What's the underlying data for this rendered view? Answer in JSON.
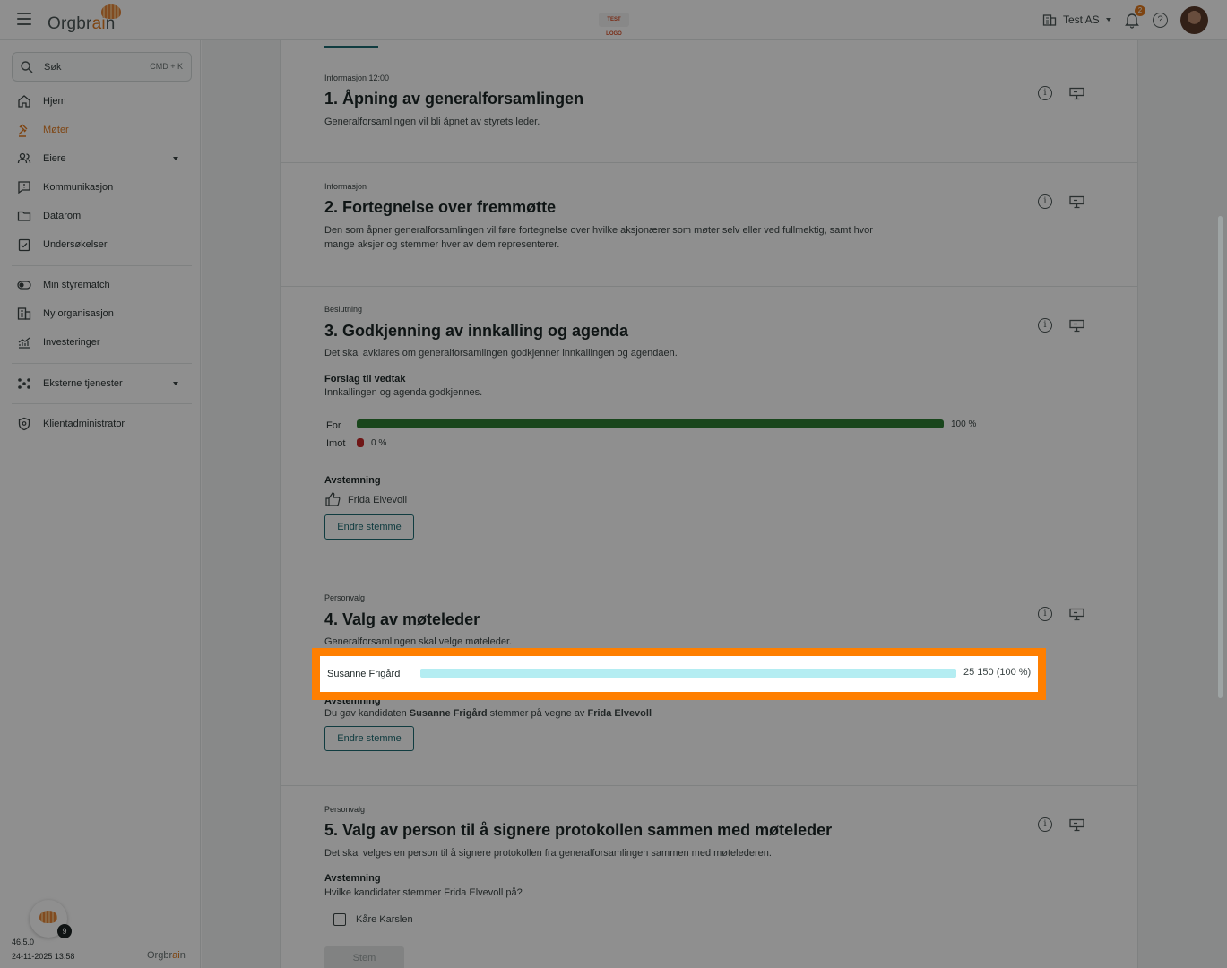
{
  "header": {
    "brand_pre": "Orgbr",
    "brand_ai": "ai",
    "brand_post": "n",
    "test_logo": "TEST LOGO",
    "org_name": "Test AS",
    "notification_count": "2",
    "help_glyph": "?"
  },
  "sidebar": {
    "search_placeholder": "Søk",
    "search_shortcut": "CMD + K",
    "items": [
      {
        "label": "Hjem",
        "icon": "home-icon"
      },
      {
        "label": "Møter",
        "icon": "gavel-icon",
        "active": true
      },
      {
        "label": "Eiere",
        "icon": "people-icon",
        "expandable": true
      },
      {
        "label": "Kommunikasjon",
        "icon": "message-icon"
      },
      {
        "label": "Datarom",
        "icon": "folder-icon"
      },
      {
        "label": "Undersøkelser",
        "icon": "clipboard-icon"
      },
      {
        "label": "Min styrematch",
        "icon": "toggle-icon"
      },
      {
        "label": "Ny organisasjon",
        "icon": "building-icon"
      },
      {
        "label": "Investeringer",
        "icon": "chart-icon"
      },
      {
        "label": "Eksterne tjenester",
        "icon": "network-icon",
        "expandable": true
      },
      {
        "label": "Klientadministrator",
        "icon": "shield-icon"
      }
    ],
    "assistant_badge_count": "9",
    "version": "46.5.0",
    "timestamp": "24-11-2025 13:58",
    "footer_brand_pre": "Orgbr",
    "footer_brand_ai": "ai",
    "footer_brand_post": "n"
  },
  "agenda": [
    {
      "kicker": "Informasjon 12:00",
      "title": "1. Åpning av generalforsamlingen",
      "description": "Generalforsamlingen vil bli åpnet av styrets leder."
    },
    {
      "kicker": "Informasjon",
      "title": "2. Fortegnelse over fremmøtte",
      "description": "Den som åpner generalforsamlingen vil føre fortegnelse over hvilke aksjonærer som møter selv eller ved fullmektig, samt hvor mange aksjer og stemmer hver av dem representerer."
    },
    {
      "kicker": "Beslutning",
      "title": "3. Godkjenning av innkalling og agenda",
      "description": "Det skal avklares om generalforsamlingen godkjenner innkallingen og agendaen.",
      "proposal_heading": "Forslag til vedtak",
      "proposal_text": "Innkallingen og agenda godkjennes.",
      "for_label": "For",
      "for_pct": "100 %",
      "for_value": 1.0,
      "against_label": "Imot",
      "against_pct": "0 %",
      "against_value": 0.0,
      "voting_heading": "Avstemning",
      "voter": "Frida Elvevoll",
      "change_vote": "Endre stemme",
      "for_color": "#2e7d32",
      "against_color": "#c62828"
    },
    {
      "kicker": "Personvalg",
      "title": "4. Valg av møteleder",
      "description": "Generalforsamlingen skal velge møteleder.",
      "candidate": "Susanne Frigård",
      "candidate_votes": "25 150 (100 %)",
      "candidate_share": 1.0,
      "voting_heading": "Avstemning",
      "vote_note_pre": "Du gav kandidaten ",
      "vote_note_candidate": "Susanne Frigård",
      "vote_note_mid": " stemmer på vegne av ",
      "vote_note_voter": "Frida Elvevoll",
      "change_vote": "Endre stemme",
      "bar_color": "#b4edf2"
    },
    {
      "kicker": "Personvalg",
      "title": "5. Valg av person til å signere protokollen sammen med møteleder",
      "description": "Det skal velges en person til å signere protokollen fra generalforsamlingen sammen med møtelederen.",
      "voting_heading": "Avstemning",
      "question": "Hvilke kandidater stemmer Frida Elvevoll på?",
      "option": "Kåre Karslen",
      "submit": "Stem"
    }
  ],
  "colors": {
    "accent": "#e07a1f",
    "teal": "#1d6b72",
    "highlight_border": "#ff7f00"
  }
}
